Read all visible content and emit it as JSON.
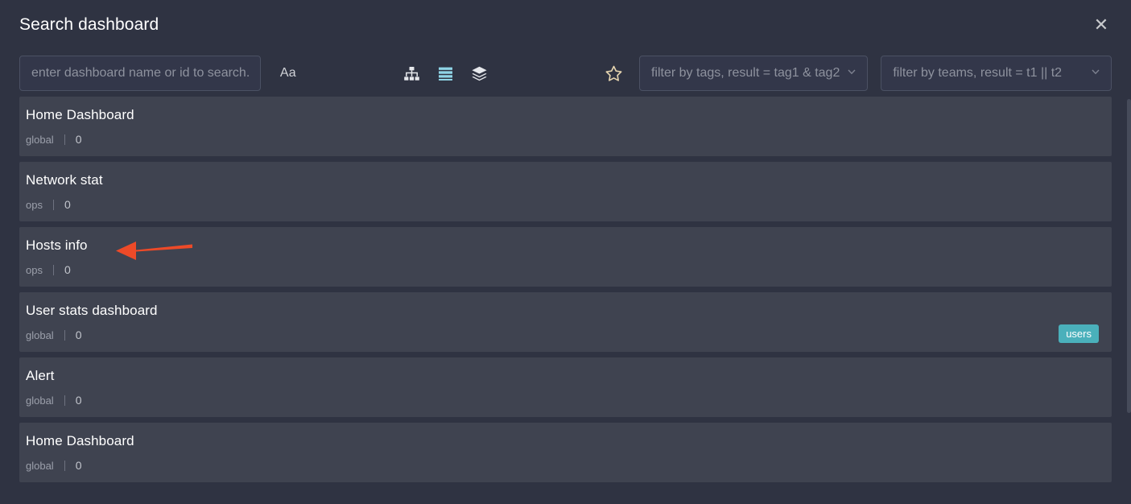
{
  "header": {
    "title": "Search dashboard",
    "close_label": "✕",
    "close_icon": "close-icon"
  },
  "toolbar": {
    "search": {
      "value": "",
      "placeholder": "enter dashboard name or id to search.."
    },
    "case_toggle_label": "Aa",
    "view_icons": [
      {
        "name": "sitemap-icon",
        "active": false
      },
      {
        "name": "list-icon",
        "active": true
      },
      {
        "name": "layers-icon",
        "active": false
      }
    ],
    "star_icon": "star-icon",
    "filter_tags": {
      "placeholder": "filter by tags, result = tag1 & tag2",
      "chevron": "chevron-down-icon"
    },
    "filter_teams": {
      "placeholder": "filter by teams, result = t1 || t2",
      "chevron": "chevron-down-icon"
    }
  },
  "colors": {
    "page_bg": "#2f3342",
    "card_bg": "#3f4350",
    "accent_active": "#7fd3e4",
    "tag_badge": "#4ab0bb",
    "star": "#e6d5b0",
    "annotation_arrow": "#ed4a28"
  },
  "list": {
    "items": [
      {
        "title": "Home Dashboard",
        "scope": "global",
        "count": "0",
        "tag": ""
      },
      {
        "title": "Network stat",
        "scope": "ops",
        "count": "0",
        "tag": ""
      },
      {
        "title": "Hosts info",
        "scope": "ops",
        "count": "0",
        "tag": ""
      },
      {
        "title": "User stats dashboard",
        "scope": "global",
        "count": "0",
        "tag": "users"
      },
      {
        "title": "Alert",
        "scope": "global",
        "count": "0",
        "tag": ""
      },
      {
        "title": "Home Dashboard",
        "scope": "global",
        "count": "0",
        "tag": ""
      }
    ]
  },
  "annotation": {
    "type": "arrow",
    "direction": "left",
    "points_to": "Hosts info"
  }
}
